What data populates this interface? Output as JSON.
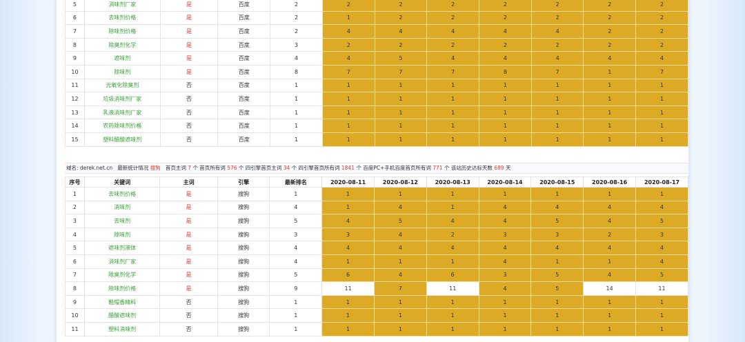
{
  "colors": {
    "gold": "#dcaa24",
    "keyword_green": "#3aa03a",
    "main_yes_red": "#e53935"
  },
  "top_table": {
    "rows": [
      {
        "no": "5",
        "kw": "消味剂厂家",
        "main": "是",
        "engine": "百度",
        "latest": "2",
        "ranks": [
          "2",
          "2",
          "2",
          "2",
          "2",
          "2",
          "2"
        ]
      },
      {
        "no": "6",
        "kw": "去味剂价格",
        "main": "是",
        "engine": "百度",
        "latest": "2",
        "ranks": [
          "1",
          "2",
          "2",
          "2",
          "2",
          "2",
          "2"
        ]
      },
      {
        "no": "7",
        "kw": "除味剂价格",
        "main": "是",
        "engine": "百度",
        "latest": "2",
        "ranks": [
          "4",
          "4",
          "4",
          "4",
          "4",
          "2",
          "2"
        ]
      },
      {
        "no": "8",
        "kw": "除臭剂化学",
        "main": "是",
        "engine": "百度",
        "latest": "3",
        "ranks": [
          "2",
          "2",
          "2",
          "2",
          "2",
          "2",
          "2"
        ]
      },
      {
        "no": "9",
        "kw": "遮味剂",
        "main": "是",
        "engine": "百度",
        "latest": "4",
        "ranks": [
          "4",
          "5",
          "4",
          "4",
          "4",
          "4",
          "4"
        ]
      },
      {
        "no": "10",
        "kw": "除味剂",
        "main": "是",
        "engine": "百度",
        "latest": "8",
        "ranks": [
          "7",
          "7",
          "7",
          "8",
          "7",
          "1",
          "7"
        ]
      },
      {
        "no": "11",
        "kw": "光氧化除臭剂",
        "main": "否",
        "engine": "百度",
        "latest": "1",
        "ranks": [
          "1",
          "1",
          "1",
          "1",
          "1",
          "1",
          "1"
        ]
      },
      {
        "no": "12",
        "kw": "垃圾消味剂厂家",
        "main": "否",
        "engine": "百度",
        "latest": "1",
        "ranks": [
          "1",
          "1",
          "1",
          "1",
          "1",
          "1",
          "1"
        ]
      },
      {
        "no": "13",
        "kw": "乳液消味剂厂家",
        "main": "否",
        "engine": "百度",
        "latest": "1",
        "ranks": [
          "1",
          "1",
          "1",
          "1",
          "1",
          "1",
          "1"
        ]
      },
      {
        "no": "14",
        "kw": "农药除味剂价格",
        "main": "否",
        "engine": "百度",
        "latest": "1",
        "ranks": [
          "1",
          "1",
          "1",
          "1",
          "1",
          "1",
          "1"
        ]
      },
      {
        "no": "15",
        "kw": "塑料醋酸遮味剂",
        "main": "否",
        "engine": "百度",
        "latest": "1",
        "ranks": [
          "1",
          "1",
          "1",
          "1",
          "1",
          "1",
          "1"
        ]
      }
    ]
  },
  "stats": {
    "domain_label": "域名:",
    "domain": "derek.net.cn",
    "latest_label": "最新统计情况",
    "engine": "搜狗",
    "home_main_label": "首页主词",
    "home_main_count": "7",
    "home_all_label": "个 首页所有词",
    "home_all_count": "576",
    "four_main_label": "个 四引擎首页主词",
    "four_main_count": "34",
    "four_all_label": "个 四引擎首页所有词",
    "four_all_count": "1841",
    "baidu_label": "个 百度PC+手机百度首页所有词",
    "baidu_count": "771",
    "history_label": "个 该站历史达标天数",
    "history_count": "689",
    "days_label": "天"
  },
  "bottom_table": {
    "headers": {
      "no": "序号",
      "kw": "关键词",
      "main": "主词",
      "engine": "引擎",
      "latest": "最新排名",
      "dates": [
        "2020-08-11",
        "2020-08-12",
        "2020-08-13",
        "2020-08-14",
        "2020-08-15",
        "2020-08-16",
        "2020-08-17"
      ]
    },
    "rows": [
      {
        "no": "1",
        "kw": "去味剂价格",
        "main": "是",
        "engine": "搜狗",
        "latest": "1",
        "ranks": [
          "1",
          "1",
          "1",
          "1",
          "1",
          "1",
          "1"
        ]
      },
      {
        "no": "2",
        "kw": "消味剂",
        "main": "是",
        "engine": "搜狗",
        "latest": "4",
        "ranks": [
          "1",
          "4",
          "1",
          "4",
          "4",
          "4",
          "4"
        ]
      },
      {
        "no": "3",
        "kw": "去味剂",
        "main": "是",
        "engine": "搜狗",
        "latest": "5",
        "ranks": [
          "4",
          "5",
          "4",
          "4",
          "5",
          "4",
          "5"
        ]
      },
      {
        "no": "4",
        "kw": "除味剂",
        "main": "是",
        "engine": "搜狗",
        "latest": "3",
        "ranks": [
          "3",
          "4",
          "2",
          "3",
          "3",
          "2",
          "3"
        ]
      },
      {
        "no": "5",
        "kw": "遮味剂液体",
        "main": "是",
        "engine": "搜狗",
        "latest": "4",
        "ranks": [
          "4",
          "4",
          "4",
          "4",
          "4",
          "4",
          "4"
        ]
      },
      {
        "no": "6",
        "kw": "消味剂厂家",
        "main": "是",
        "engine": "搜狗",
        "latest": "4",
        "ranks": [
          "1",
          "1",
          "1",
          "4",
          "1",
          "1",
          "4"
        ]
      },
      {
        "no": "7",
        "kw": "除臭剂化学",
        "main": "是",
        "engine": "搜狗",
        "latest": "5",
        "ranks": [
          "6",
          "4",
          "6",
          "3",
          "5",
          "4",
          "5"
        ]
      },
      {
        "no": "8",
        "kw": "除味剂价格",
        "main": "是",
        "engine": "搜狗",
        "latest": "9",
        "ranks": [
          "11",
          "7",
          "11",
          "4",
          "5",
          "14",
          "11"
        ],
        "gold": [
          false,
          true,
          false,
          true,
          true,
          false,
          false
        ]
      },
      {
        "no": "9",
        "kw": "鞋帽香精料",
        "main": "否",
        "engine": "搜狗",
        "latest": "1",
        "ranks": [
          "1",
          "1",
          "1",
          "1",
          "1",
          "1",
          "1"
        ]
      },
      {
        "no": "10",
        "kw": "醋酸遮味剂",
        "main": "否",
        "engine": "搜狗",
        "latest": "1",
        "ranks": [
          "1",
          "1",
          "1",
          "1",
          "1",
          "1",
          "1"
        ]
      },
      {
        "no": "11",
        "kw": "塑料消味剂",
        "main": "否",
        "engine": "搜狗",
        "latest": "1",
        "ranks": [
          "1",
          "1",
          "1",
          "1",
          "1",
          "1",
          "1"
        ]
      }
    ]
  }
}
